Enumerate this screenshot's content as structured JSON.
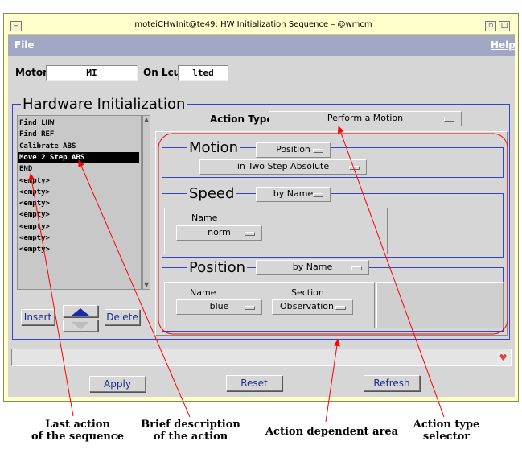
{
  "window": {
    "title": "moteiCHwInit@te49: HW Initialization Sequence – @wmcm",
    "menu_left": "File",
    "menu_right": "Help"
  },
  "motor": {
    "label": "Motor",
    "value": "MI"
  },
  "lcu": {
    "label": "On Lcu",
    "value": "lted"
  },
  "group_title": "Hardware Initialization",
  "actions": [
    "Find LHW",
    "Find REF",
    "Calibrate ABS",
    "Move 2 Step ABS",
    "END",
    "<empty>",
    "<empty>",
    "<empty>",
    "<empty>",
    "<empty>",
    "<empty>",
    "<empty>"
  ],
  "selected_action_index": 3,
  "list_buttons": {
    "insert": "Insert",
    "delete": "Delete"
  },
  "action_type": {
    "label": "Action Type",
    "value": "Perform a Motion"
  },
  "motion": {
    "title": "Motion",
    "mode": "Position",
    "sub": "in Two Step Absolute"
  },
  "speed": {
    "title": "Speed",
    "mode": "by Name",
    "name_label": "Name",
    "name_value": "norm"
  },
  "position": {
    "title": "Position",
    "mode": "by Name",
    "name_label": "Name",
    "name_value": "blue",
    "section_label": "Section",
    "section_value": "Observation"
  },
  "buttons": {
    "apply": "Apply",
    "reset": "Reset",
    "refresh": "Refresh"
  },
  "annotations": {
    "last_action_1": "Last action",
    "last_action_2": "of the sequence",
    "brief_1": "Brief description",
    "brief_2": "of the action",
    "dependent": "Action dependent area",
    "selector_1": "Action type",
    "selector_2": "selector"
  },
  "colors": {
    "group_border": "#3344cc",
    "menubar": "#a0a8c4",
    "annotation": "#ff0000",
    "selected_row": "#000000"
  }
}
